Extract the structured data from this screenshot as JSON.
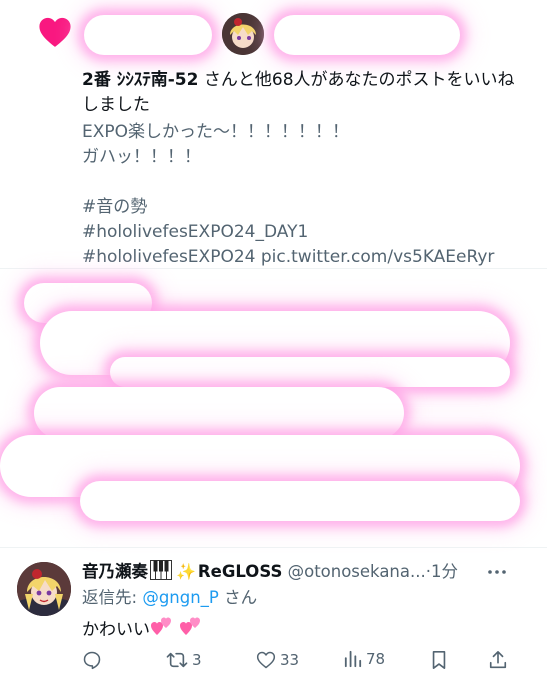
{
  "like_notification": {
    "liker_name": "2番 ｼｼｽﾃ南-52",
    "text_suffix": "さんと他68人があなたのポストをいいねしました"
  },
  "tweet": {
    "body": "EXPO楽しかった〜！！！！！！！\nガハッ！！！！\n\n#音の勢\n#hololivefesEXPO24_DAY1\n#hololivefesEXPO24 pic.twitter.com/vs5KAEeRyr"
  },
  "reply": {
    "display_name": "音乃瀬奏",
    "group_name": "ReGLOSS",
    "handle": "@otonosekana...",
    "separator": "·",
    "time": "1分",
    "replying_label": "返信先:",
    "replying_mention": "@gngn_P",
    "replying_suffix": "さん",
    "text": "かわいい",
    "actions": {
      "retweet_count": "3",
      "like_count": "33",
      "view_count": "78"
    }
  },
  "colors": {
    "heart": "#f91880",
    "accent": "#1d9bf0",
    "muted": "#536471",
    "blur_glow": "#ffa0e6"
  },
  "icons": [
    "heart-icon",
    "more-icon",
    "reply-icon",
    "retweet-icon",
    "like-icon",
    "views-icon",
    "bookmark-icon",
    "share-icon",
    "piano-icon",
    "sparkle-icon",
    "hearts-emoji"
  ]
}
